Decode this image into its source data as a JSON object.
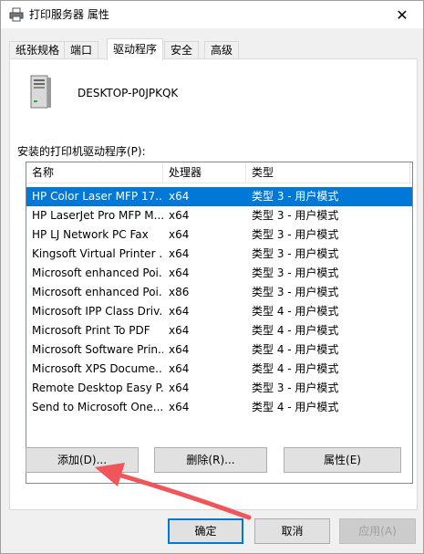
{
  "window": {
    "title": "打印服务器 属性",
    "close_glyph": "✕"
  },
  "tabs": [
    {
      "label": "纸张规格"
    },
    {
      "label": "端口"
    },
    {
      "label": "驱动程序"
    },
    {
      "label": "安全"
    },
    {
      "label": "高级"
    }
  ],
  "active_tab": "驱动程序",
  "server": {
    "name": "DESKTOP-P0JPKQK"
  },
  "drivers": {
    "label": "安装的打印机驱动程序(P):",
    "columns": [
      "名称",
      "处理器",
      "类型"
    ],
    "rows": [
      {
        "name": "HP Color Laser MFP 17...",
        "processor": "x64",
        "type": "类型 3 - 用户模式"
      },
      {
        "name": "HP LaserJet Pro MFP M...",
        "processor": "x64",
        "type": "类型 3 - 用户模式"
      },
      {
        "name": "HP LJ Network PC Fax",
        "processor": "x64",
        "type": "类型 3 - 用户模式"
      },
      {
        "name": "Kingsoft Virtual Printer ...",
        "processor": "x64",
        "type": "类型 3 - 用户模式"
      },
      {
        "name": "Microsoft enhanced Poi...",
        "processor": "x64",
        "type": "类型 3 - 用户模式"
      },
      {
        "name": "Microsoft enhanced Poi...",
        "processor": "x86",
        "type": "类型 3 - 用户模式"
      },
      {
        "name": "Microsoft IPP Class Driv...",
        "processor": "x64",
        "type": "类型 4 - 用户模式"
      },
      {
        "name": "Microsoft Print To PDF",
        "processor": "x64",
        "type": "类型 4 - 用户模式"
      },
      {
        "name": "Microsoft Software Prin...",
        "processor": "x64",
        "type": "类型 4 - 用户模式"
      },
      {
        "name": "Microsoft XPS Docume...",
        "processor": "x64",
        "type": "类型 4 - 用户模式"
      },
      {
        "name": "Remote Desktop Easy P...",
        "processor": "x64",
        "type": "类型 3 - 用户模式"
      },
      {
        "name": "Send to Microsoft One...",
        "processor": "x64",
        "type": "类型 4 - 用户模式"
      }
    ],
    "selected_index": 0
  },
  "actions": {
    "add": "添加(D)...",
    "remove": "删除(R)...",
    "properties": "属性(E)"
  },
  "dialog_buttons": {
    "ok": "确定",
    "cancel": "取消",
    "apply": "应用(A)"
  },
  "colors": {
    "selection": "#0078d7",
    "arrow": "#f0555a"
  },
  "icons": {
    "window": "printer-icon",
    "server": "server-tower-icon",
    "close": "close-icon"
  }
}
